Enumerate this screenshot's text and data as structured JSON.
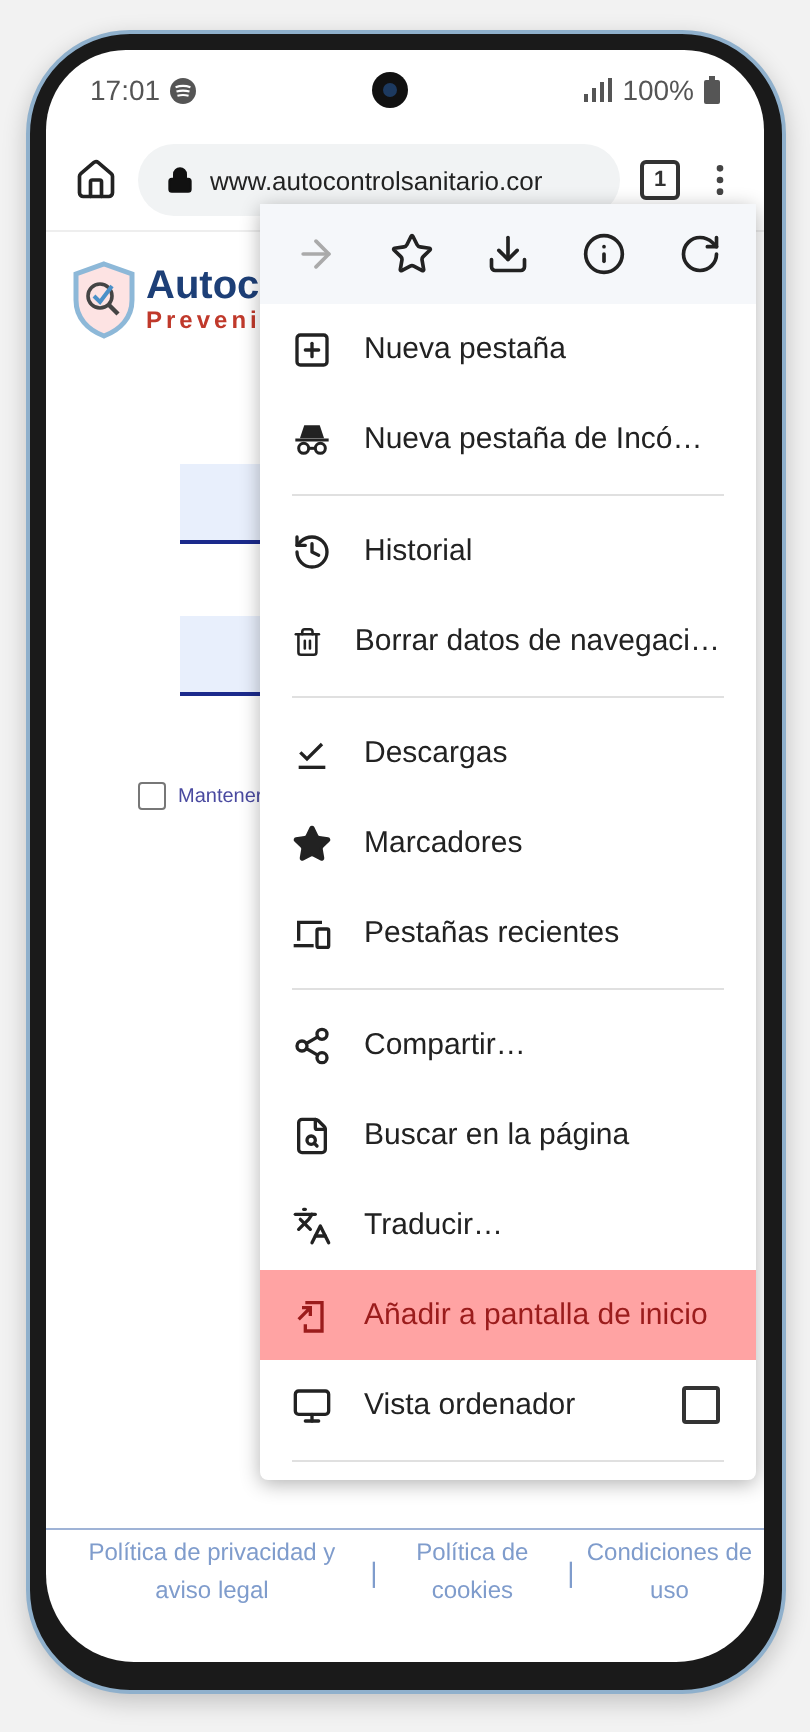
{
  "status_bar": {
    "time": "17:01",
    "battery": "100%"
  },
  "toolbar": {
    "url": "www.autocontrolsanitario.cor",
    "tab_count": "1"
  },
  "page": {
    "logo_title": "Autoc",
    "logo_subtitle": "Preveni",
    "fields": [
      {
        "kind": "field"
      },
      {
        "kind": "field"
      }
    ],
    "remember": {
      "label": "Mantener",
      "checked": false
    }
  },
  "menu": {
    "top_actions": [
      {
        "disabled": true
      },
      {
        "disabled": false
      },
      {
        "disabled": false
      },
      {
        "disabled": false
      },
      {
        "disabled": false
      }
    ],
    "groups": [
      [
        {
          "label": "Nueva pestaña",
          "kind": "item",
          "highlighted": false
        },
        {
          "label": "Nueva pestaña de Incó…",
          "kind": "item",
          "highlighted": false
        }
      ],
      [
        {
          "label": "Historial",
          "kind": "item",
          "highlighted": false
        },
        {
          "label": "Borrar datos de navegaci…",
          "kind": "item",
          "highlighted": false
        }
      ],
      [
        {
          "label": "Descargas",
          "kind": "item",
          "highlighted": false
        },
        {
          "label": "Marcadores",
          "kind": "item",
          "highlighted": false
        },
        {
          "label": "Pestañas recientes",
          "kind": "item",
          "highlighted": false
        }
      ],
      [
        {
          "label": "Compartir…",
          "kind": "item",
          "highlighted": false
        },
        {
          "label": "Buscar en la página",
          "kind": "item",
          "highlighted": false
        },
        {
          "label": "Traducir…",
          "kind": "item",
          "highlighted": false
        },
        {
          "label": "Añadir a pantalla de inicio",
          "kind": "item",
          "highlighted": true
        },
        {
          "label": "Vista ordenador",
          "kind": "checkbox",
          "checked": false,
          "highlighted": false
        }
      ]
    ]
  },
  "footer": {
    "links": [
      "Política de privacidad y aviso legal",
      "Política de cookies",
      "Condiciones de uso"
    ],
    "separators": [
      "|",
      "|"
    ]
  }
}
